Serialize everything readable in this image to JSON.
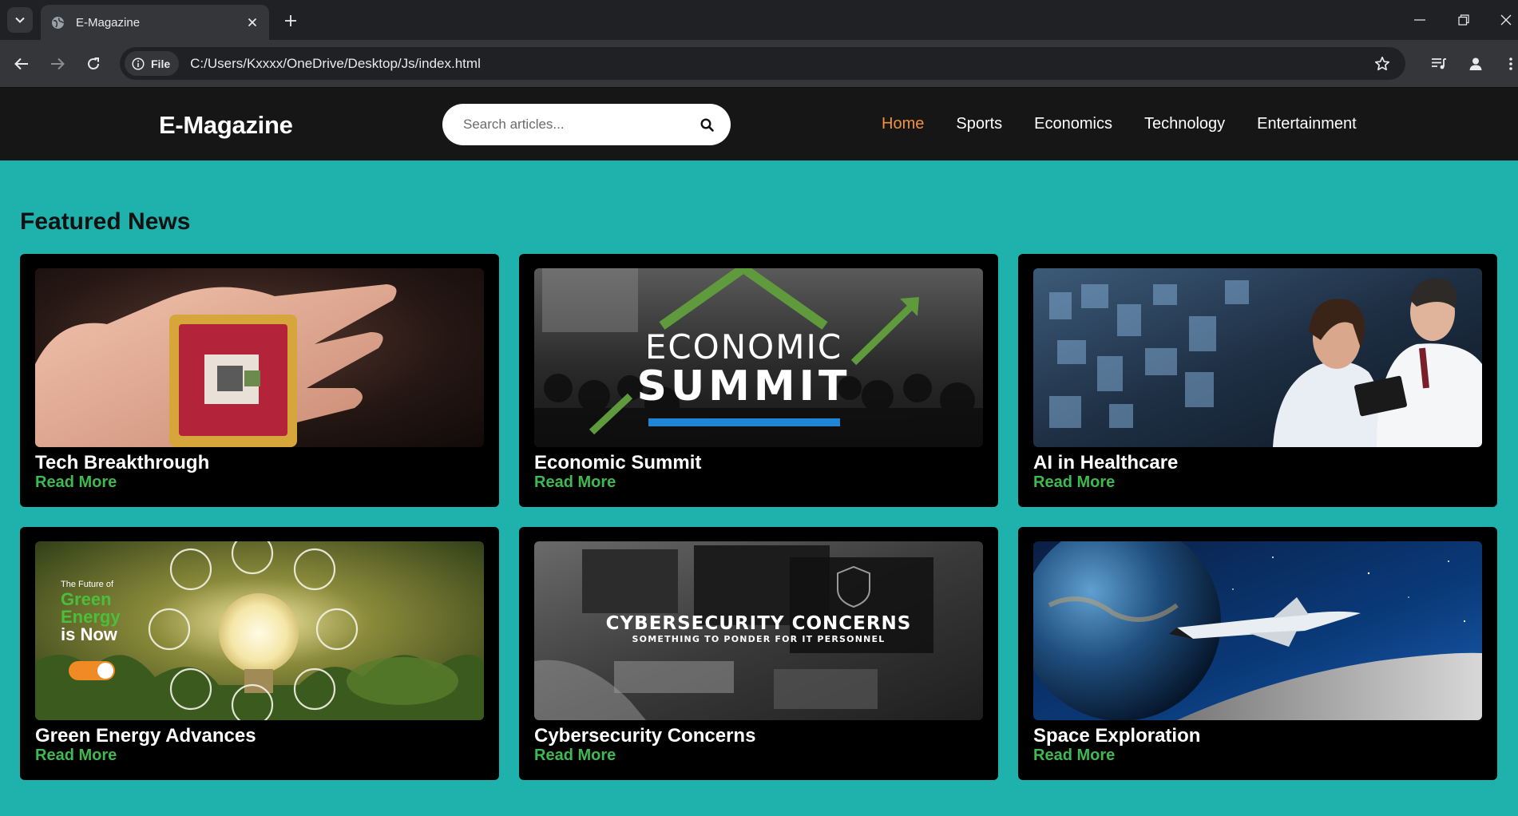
{
  "browser": {
    "tab_title": "E-Magazine",
    "site_chip": "File",
    "url": "C:/Users/Kxxxx/OneDrive/Desktop/Js/index.html",
    "icons": [
      "tab-list-icon",
      "globe-icon",
      "close-icon",
      "plus-icon",
      "minimize-icon",
      "restore-icon",
      "close-window-icon",
      "back-arrow-icon",
      "forward-arrow-icon",
      "reload-icon",
      "info-icon",
      "star-icon",
      "media-queue-icon",
      "profile-icon",
      "kebab-menu-icon"
    ]
  },
  "header": {
    "logo": "E-Magazine",
    "search_placeholder": "Search articles...",
    "nav": [
      {
        "label": "Home",
        "active": true
      },
      {
        "label": "Sports",
        "active": false
      },
      {
        "label": "Economics",
        "active": false
      },
      {
        "label": "Technology",
        "active": false
      },
      {
        "label": "Entertainment",
        "active": false
      }
    ]
  },
  "featured": {
    "heading": "Featured News",
    "cards": [
      {
        "title": "Tech Breakthrough",
        "link": "Read More"
      },
      {
        "title": "Economic Summit",
        "link": "Read More",
        "image_text": [
          "ECONOMIC",
          "SUMMIT"
        ]
      },
      {
        "title": "AI in Healthcare",
        "link": "Read More"
      },
      {
        "title": "Green Energy Advances",
        "link": "Read More",
        "image_text": [
          "The Future of",
          "Green",
          "Energy",
          "is Now"
        ]
      },
      {
        "title": "Cybersecurity Concerns",
        "link": "Read More",
        "image_text": [
          "CYBERSECURITY CONCERNS",
          "SOMETHING TO PONDER FOR IT PERSONNEL"
        ]
      },
      {
        "title": "Space Exploration",
        "link": "Read More"
      }
    ]
  },
  "colors": {
    "page_bg": "#1fb1ab",
    "header_bg": "#161616",
    "nav_active": "#f0923c",
    "read_more": "#3fb950",
    "card_bg": "#000000"
  }
}
